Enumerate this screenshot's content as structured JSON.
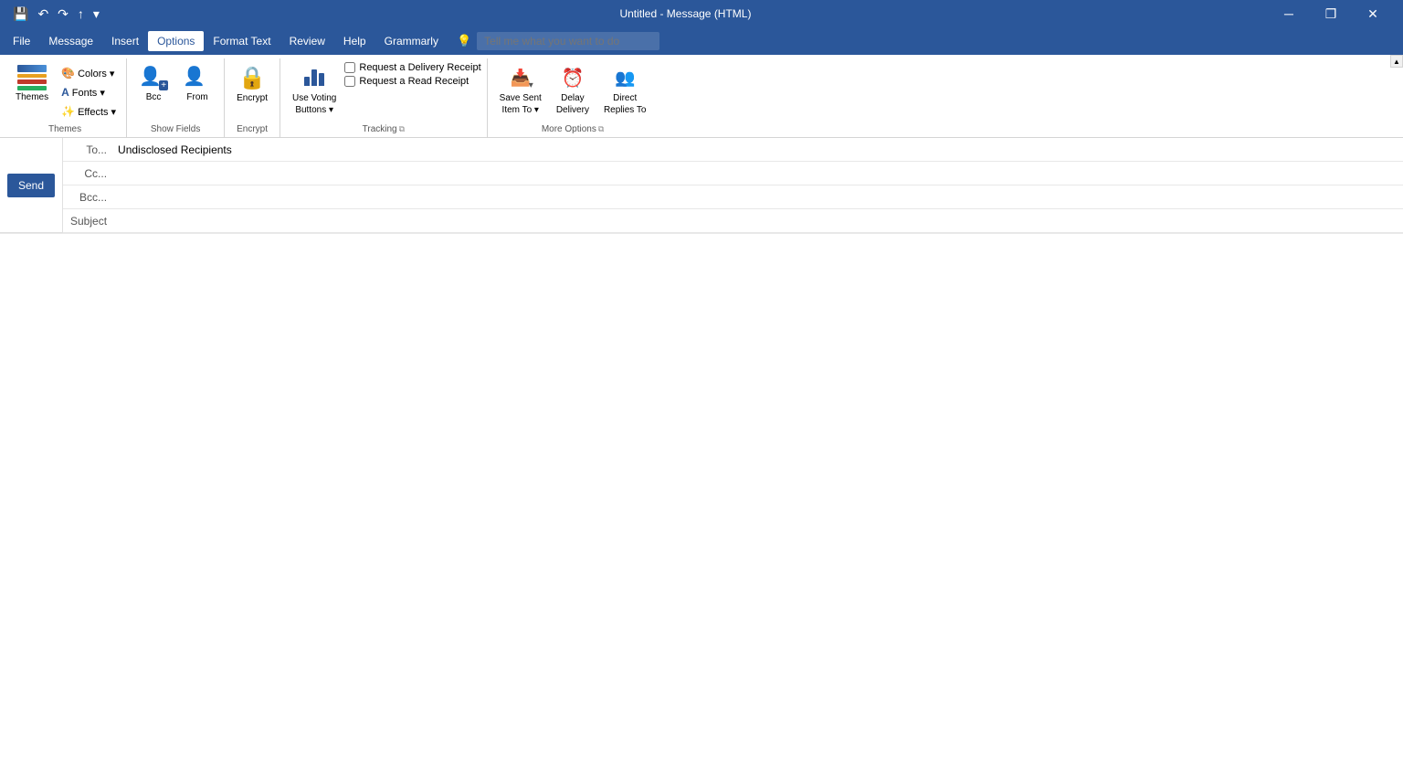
{
  "titlebar": {
    "title": "Untitled - Message (HTML)",
    "minimize": "─",
    "restore": "❐",
    "close": "✕"
  },
  "quickaccess": {
    "save": "💾",
    "undo": "↶",
    "redo": "↷",
    "up": "↑",
    "more": "▾"
  },
  "menubar": {
    "items": [
      {
        "label": "File",
        "active": false
      },
      {
        "label": "Message",
        "active": false
      },
      {
        "label": "Insert",
        "active": false
      },
      {
        "label": "Options",
        "active": true
      },
      {
        "label": "Format Text",
        "active": false
      },
      {
        "label": "Review",
        "active": false
      },
      {
        "label": "Help",
        "active": false
      },
      {
        "label": "Grammarly",
        "active": false
      }
    ],
    "search_placeholder": "Tell me what you want to do",
    "search_icon": "💡"
  },
  "ribbon": {
    "groups": [
      {
        "id": "themes",
        "label": "Themes",
        "buttons": [
          {
            "id": "themes-main",
            "label": "Themes",
            "icon": "theme",
            "size": "large",
            "dropdown": true
          },
          {
            "id": "colors",
            "label": "Colors ▾",
            "icon": "🎨",
            "size": "small"
          },
          {
            "id": "fonts",
            "label": "Fonts ▾",
            "icon": "A",
            "size": "small"
          },
          {
            "id": "effects",
            "label": "Effects ▾",
            "icon": "✨",
            "size": "small"
          }
        ]
      },
      {
        "id": "show-fields",
        "label": "Show Fields",
        "buttons": [
          {
            "id": "bcc",
            "label": "Bcc",
            "icon": "👤",
            "size": "large"
          },
          {
            "id": "from",
            "label": "From",
            "icon": "👤",
            "size": "large"
          }
        ]
      },
      {
        "id": "encrypt",
        "label": "Encrypt",
        "buttons": [
          {
            "id": "encrypt-btn",
            "label": "Encrypt",
            "icon": "🔒",
            "size": "large"
          }
        ]
      },
      {
        "id": "tracking",
        "label": "Tracking",
        "has_expand": true,
        "buttons": [
          {
            "id": "use-voting",
            "label": "Use Voting\nButtons ▾",
            "icon": "📊",
            "size": "large"
          }
        ],
        "checkboxes": [
          {
            "id": "delivery-receipt",
            "label": "Request a Delivery Receipt"
          },
          {
            "id": "read-receipt",
            "label": "Request a Read Receipt"
          }
        ]
      },
      {
        "id": "more-options",
        "label": "More Options",
        "has_expand": true,
        "buttons": [
          {
            "id": "save-sent-item",
            "label": "Save Sent\nItem To ▾",
            "icon": "save",
            "size": "large"
          },
          {
            "id": "delay-delivery",
            "label": "Delay\nDelivery",
            "icon": "delay",
            "size": "large"
          },
          {
            "id": "direct-replies",
            "label": "Direct\nReplies To",
            "icon": "reply",
            "size": "large"
          }
        ]
      }
    ]
  },
  "compose": {
    "to_label": "To...",
    "to_value": "Undisclosed Recipients",
    "cc_label": "Cc...",
    "cc_value": "",
    "bcc_label": "Bcc...",
    "bcc_value": "",
    "subject_label": "Subject",
    "subject_value": "",
    "send_label": "Send"
  }
}
